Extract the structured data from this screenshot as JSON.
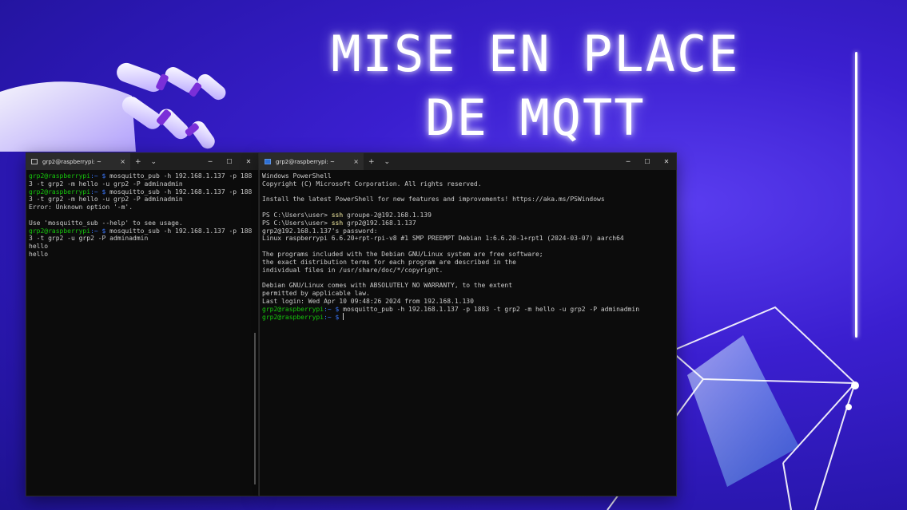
{
  "headline": {
    "line1": "MISE EN PLACE",
    "line2": "DE MQTT"
  },
  "left_terminal": {
    "tab_title": "grp2@raspberrypi: ~",
    "tab_close": "×",
    "new_tab": "+",
    "dropdown": "⌄",
    "minimize": "─",
    "maximize": "☐",
    "close": "✕",
    "lines": [
      {
        "user": "grp2@raspberrypi",
        "path": ":~ $",
        "cmd": " mosquitto_pub -h 192.168.1.137 -p 1883 -t grp2 -m hello -u grp2 -P adminadmin"
      },
      {
        "user": "grp2@raspberrypi",
        "path": ":~ $",
        "cmd": " mosquitto_sub -h 192.168.1.137 -p 1883 -t grp2 -m hello -u grp2 -P adminadmin"
      },
      {
        "text": "Error: Unknown option '-m'."
      },
      {
        "text": ""
      },
      {
        "text": "Use 'mosquitto_sub --help' to see usage."
      },
      {
        "user": "grp2@raspberrypi",
        "path": ":~ $",
        "cmd": " mosquitto_sub -h 192.168.1.137 -p 1883 -t grp2 -u grp2 -P adminadmin"
      },
      {
        "text": "hello"
      },
      {
        "text": "hello"
      }
    ]
  },
  "right_terminal": {
    "tab_title": "grp2@raspberrypi: ~",
    "tab_close": "×",
    "new_tab": "+",
    "dropdown": "⌄",
    "minimize": "─",
    "maximize": "☐",
    "close": "✕",
    "lines": [
      {
        "text": "Windows PowerShell"
      },
      {
        "text": "Copyright (C) Microsoft Corporation. All rights reserved."
      },
      {
        "text": ""
      },
      {
        "text": "Install the latest PowerShell for new features and improvements! https://aka.ms/PSWindows"
      },
      {
        "text": ""
      },
      {
        "ps": "PS C:\\Users\\user> ",
        "ssh": "ssh",
        "rest": " groupe-2@192.168.1.139"
      },
      {
        "ps": "PS C:\\Users\\user> ",
        "ssh": "ssh",
        "rest": " grp2@192.168.1.137"
      },
      {
        "text": "grp2@192.168.1.137's password:"
      },
      {
        "text": "Linux raspberrypi 6.6.20+rpt-rpi-v8 #1 SMP PREEMPT Debian 1:6.6.20-1+rpt1 (2024-03-07) aarch64"
      },
      {
        "text": ""
      },
      {
        "text": "The programs included with the Debian GNU/Linux system are free software;"
      },
      {
        "text": "the exact distribution terms for each program are described in the"
      },
      {
        "text": "individual files in /usr/share/doc/*/copyright."
      },
      {
        "text": ""
      },
      {
        "text": "Debian GNU/Linux comes with ABSOLUTELY NO WARRANTY, to the extent"
      },
      {
        "text": "permitted by applicable law."
      },
      {
        "text": "Last login: Wed Apr 10 09:48:26 2024 from 192.168.1.130"
      },
      {
        "user": "grp2@raspberrypi",
        "path": ":~ $",
        "cmd": " mosquitto_pub -h 192.168.1.137 -p 1883 -t grp2 -m hello -u grp2 -P adminadmin"
      },
      {
        "user": "grp2@raspberrypi",
        "path": ":~ $",
        "cmd": " ",
        "cursor": true
      }
    ]
  },
  "colors": {
    "prompt_user": "#16c60c",
    "prompt_path": "#3b78ff",
    "ssh_keyword": "#f9f1a5",
    "terminal_bg": "#0c0c0c",
    "background": "#3b1fd0"
  }
}
